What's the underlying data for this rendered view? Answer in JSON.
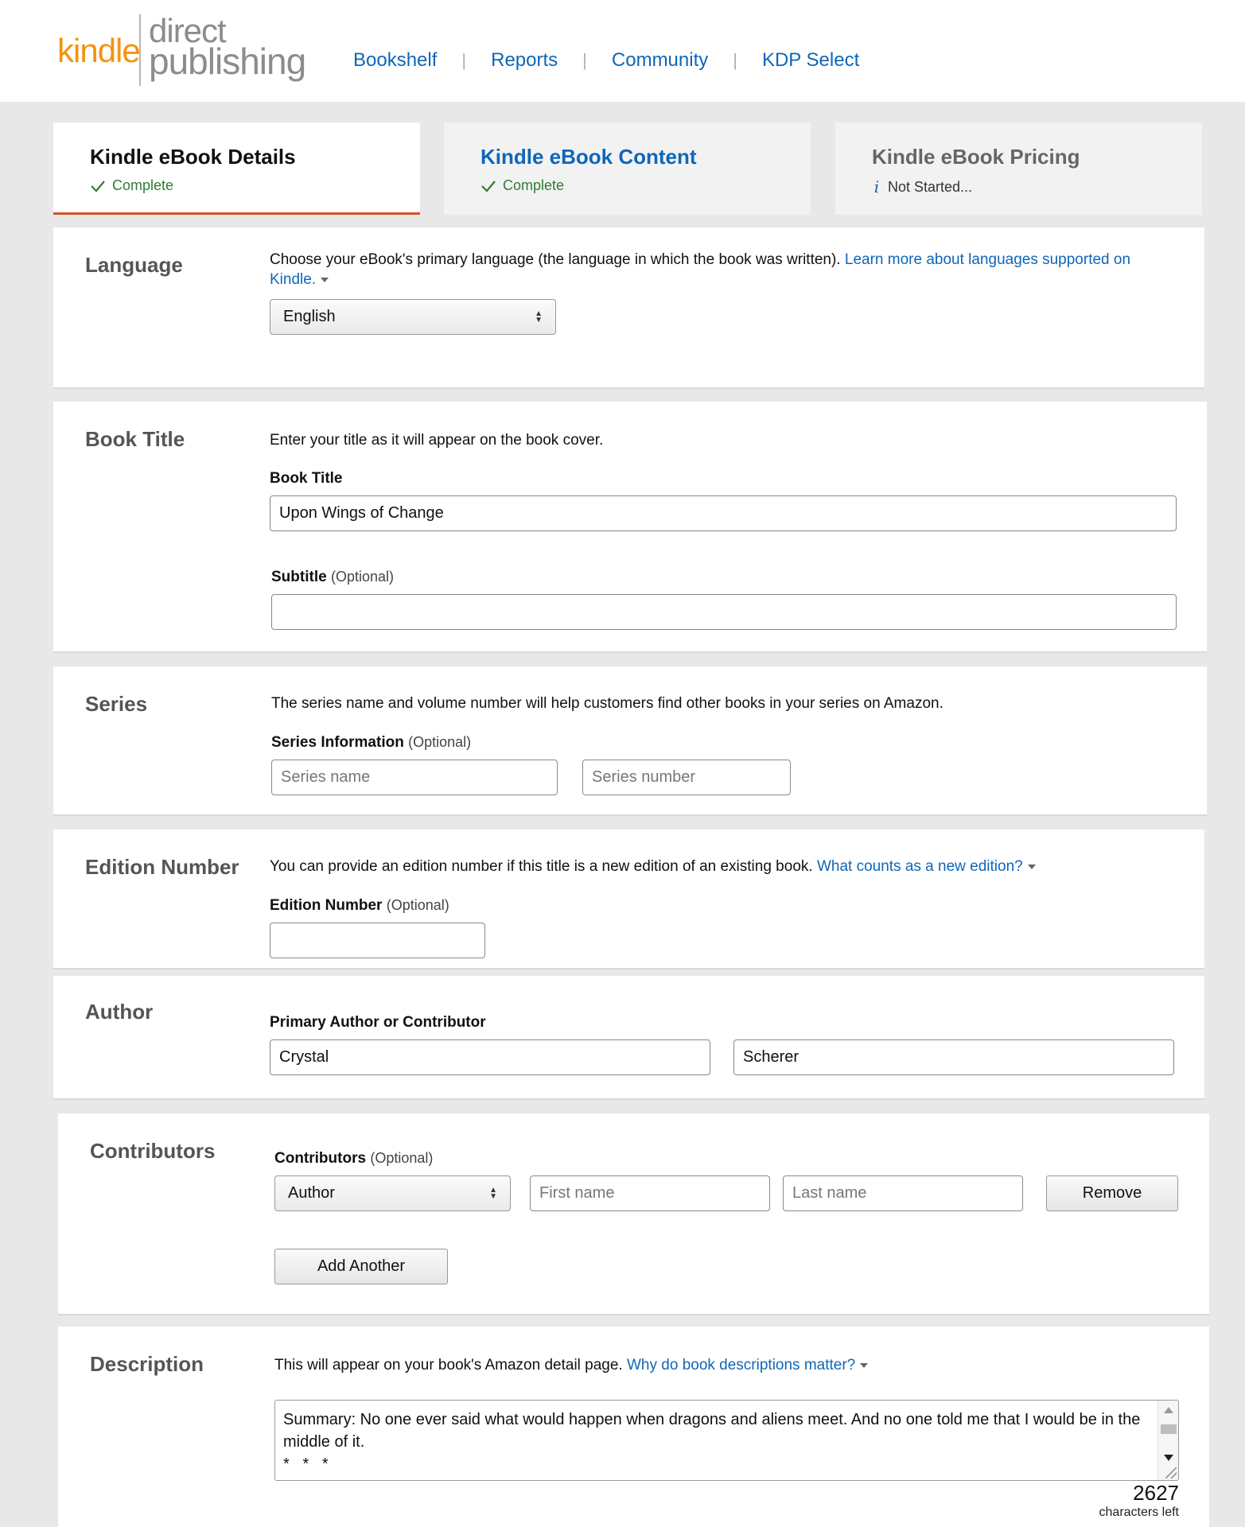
{
  "header": {
    "logo": {
      "kindle": "kindle",
      "direct": "direct",
      "publishing": "publishing"
    },
    "nav": [
      "Bookshelf",
      "Reports",
      "Community",
      "KDP Select"
    ]
  },
  "tabs": [
    {
      "title": "Kindle eBook Details",
      "status": "Complete",
      "status_icon": "check-icon"
    },
    {
      "title": "Kindle eBook Content",
      "status": "Complete",
      "status_icon": "check-icon"
    },
    {
      "title": "Kindle eBook Pricing",
      "status": "Not Started...",
      "status_icon": "info-icon"
    }
  ],
  "language": {
    "label": "Language",
    "description": "Choose your eBook's primary language (the language in which the book was written).",
    "link": "Learn more about languages supported on Kindle.",
    "selected": "English"
  },
  "book_title": {
    "label": "Book Title",
    "description": "Enter your title as it will appear on the book cover.",
    "field_label": "Book Title",
    "value": "Upon Wings of Change",
    "subtitle_label": "Subtitle",
    "subtitle_optional": "(Optional)",
    "subtitle_value": ""
  },
  "series": {
    "label": "Series",
    "description": "The series name and volume number will help customers find other books in your series on Amazon.",
    "field_label": "Series Information",
    "optional": "(Optional)",
    "name_placeholder": "Series name",
    "number_placeholder": "Series number"
  },
  "edition": {
    "label": "Edition Number",
    "description": "You can provide an edition number if this title is a new edition of an existing book.",
    "link": "What counts as a new edition?",
    "field_label": "Edition Number",
    "optional": "(Optional)",
    "value": ""
  },
  "author": {
    "label": "Author",
    "field_label": "Primary Author or Contributor",
    "first_name": "Crystal",
    "last_name": "Scherer"
  },
  "contributors": {
    "label": "Contributors",
    "field_label": "Contributors",
    "optional": "(Optional)",
    "role": "Author",
    "first_placeholder": "First name",
    "last_placeholder": "Last name",
    "remove": "Remove",
    "add_another": "Add Another"
  },
  "description_section": {
    "label": "Description",
    "description": "This will appear on your book's Amazon detail page.",
    "link": "Why do book descriptions matter?",
    "text": "Summary: No one ever said what would happen when dragons and aliens meet. And no one told me that I would be in the middle of it.\n*   *   *",
    "chars_left": "2627",
    "chars_left_label": "characters left"
  }
}
